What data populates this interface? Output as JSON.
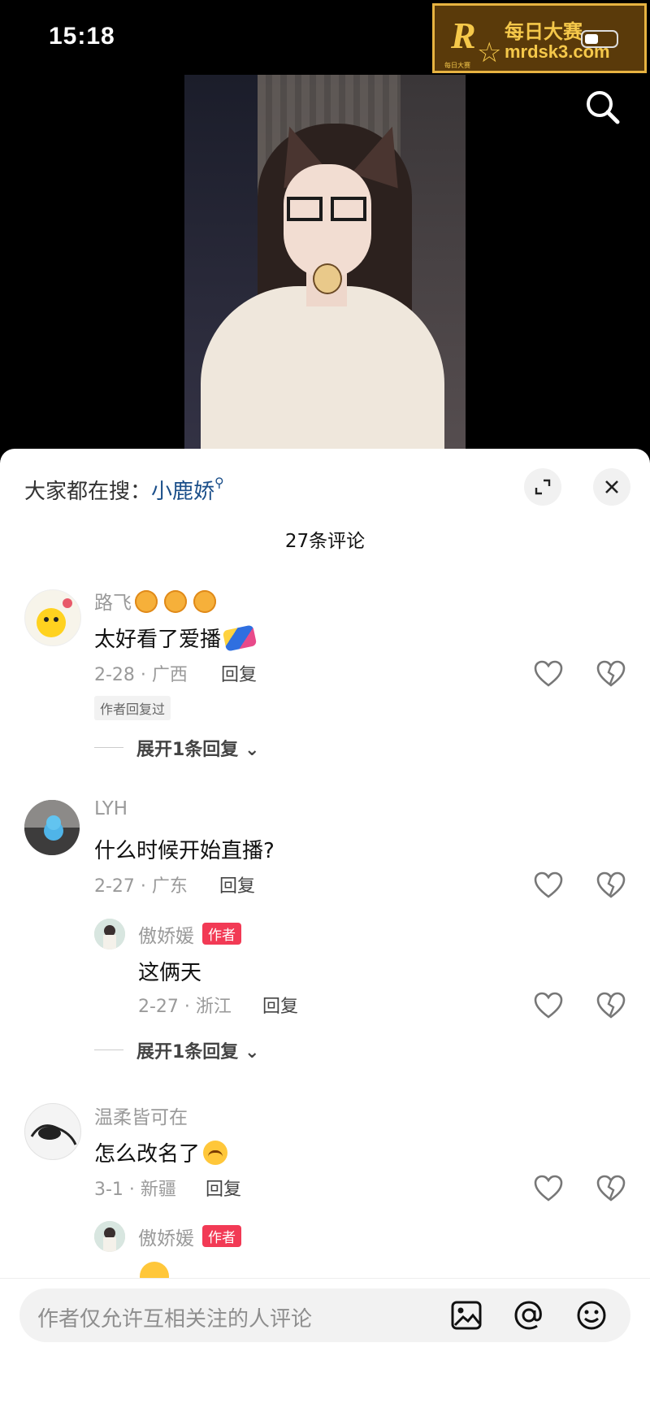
{
  "status_bar": {
    "time": "15:18"
  },
  "watermark": {
    "cn": "每日大赛",
    "url": "mrdsk3.com",
    "sub": "每日大赛",
    "r_glyph": "R",
    "star_glyph": "☆"
  },
  "header": {
    "search_icon": "search-icon"
  },
  "sheet": {
    "hot_search_prefix": "大家都在搜：",
    "hot_search_keyword": "小鹿娇",
    "comment_count": "27条评论",
    "expand_icon": "expand-icon",
    "close_icon": "close-icon"
  },
  "comments": [
    {
      "name": "路飞",
      "text": "太好看了爱播",
      "meta": "2-28 · 广西",
      "reply_label": "回复",
      "tag": "作者回复过",
      "expand": "展开1条回复"
    },
    {
      "name": "LYH",
      "text": "什么时候开始直播?",
      "meta": "2-27 · 广东",
      "reply_label": "回复",
      "sub": {
        "name": "傲娇媛",
        "badge": "作者",
        "text": "这俩天",
        "meta": "2-27 · 浙江",
        "reply_label": "回复"
      },
      "expand": "展开1条回复"
    },
    {
      "name": "温柔皆可在",
      "text": "怎么改名了",
      "meta": "3-1 · 新疆",
      "reply_label": "回复",
      "sub": {
        "name": "傲娇媛",
        "badge": "作者"
      }
    }
  ],
  "input_bar": {
    "placeholder": "作者仅允许互相关注的人评论",
    "icons": [
      "image-icon",
      "at-icon",
      "emoji-icon"
    ]
  },
  "colors": {
    "link": "#1b4f8a",
    "author_badge": "#f23a55",
    "sheet_bg": "#ffffff"
  }
}
